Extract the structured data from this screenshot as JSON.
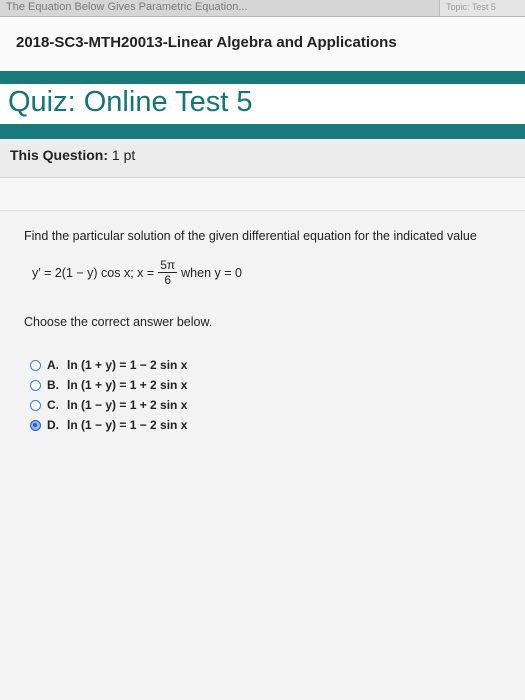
{
  "browser": {
    "tab_title": "The Equation Below Gives Parametric Equation...",
    "tab_right": "Topic: Test 5"
  },
  "course": {
    "title": "2018-SC3-MTH20013-Linear Algebra and Applications"
  },
  "quiz": {
    "title": "Quiz: Online Test 5"
  },
  "question_header": {
    "label": "This Question:",
    "points": "1 pt"
  },
  "question": {
    "prompt": "Find the particular solution of the given differential equation for the indicated value",
    "equation_left": "y′ = 2(1 − y) cos x; x =",
    "fraction_numerator": "5π",
    "fraction_denominator": "6",
    "equation_right": "when y = 0",
    "instruction": "Choose the correct answer below."
  },
  "options": [
    {
      "letter": "A.",
      "text": "ln (1 + y) = 1 − 2 sin x",
      "selected": false
    },
    {
      "letter": "B.",
      "text": "ln (1 + y) = 1 + 2 sin x",
      "selected": false
    },
    {
      "letter": "C.",
      "text": "ln (1 − y) = 1 + 2 sin x",
      "selected": false
    },
    {
      "letter": "D.",
      "text": "ln (1 − y) = 1 − 2 sin x",
      "selected": true
    }
  ]
}
